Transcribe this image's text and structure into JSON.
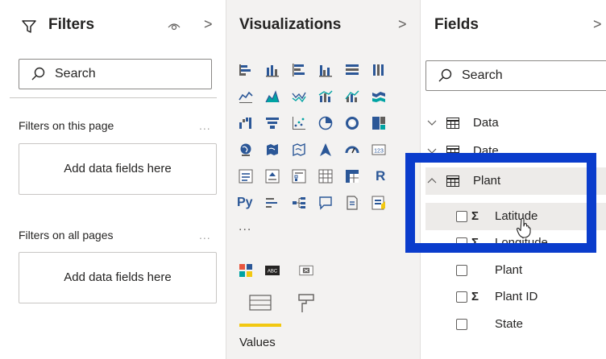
{
  "filters": {
    "title": "Filters",
    "search_placeholder": "Search",
    "on_this_page_label": "Filters on this page",
    "on_this_page_dots": "...",
    "on_this_page_well": "Add data fields here",
    "on_all_pages_label": "Filters on all pages",
    "on_all_pages_dots": "...",
    "on_all_pages_well": "Add data fields here"
  },
  "visualizations": {
    "title": "Visualizations",
    "more_label": "...",
    "python_visual": "Py",
    "r_visual": "R",
    "values_label": "Values"
  },
  "fields": {
    "title": "Fields",
    "search_placeholder": "Search",
    "tables": [
      {
        "name": "Data",
        "expanded": false
      },
      {
        "name": "Date",
        "expanded": false
      },
      {
        "name": "Plant",
        "expanded": true
      }
    ],
    "plant_fields": [
      {
        "name": "Latitude",
        "sigma": true
      },
      {
        "name": "Longitude",
        "sigma": true
      },
      {
        "name": "Plant",
        "sigma": false
      },
      {
        "name": "Plant ID",
        "sigma": true
      },
      {
        "name": "State",
        "sigma": false
      }
    ]
  },
  "colors": {
    "highlight": "#0a3ccc",
    "accent_underline": "#f2c811",
    "viz_blue": "#2b5797",
    "viz_teal": "#00a3a3"
  }
}
